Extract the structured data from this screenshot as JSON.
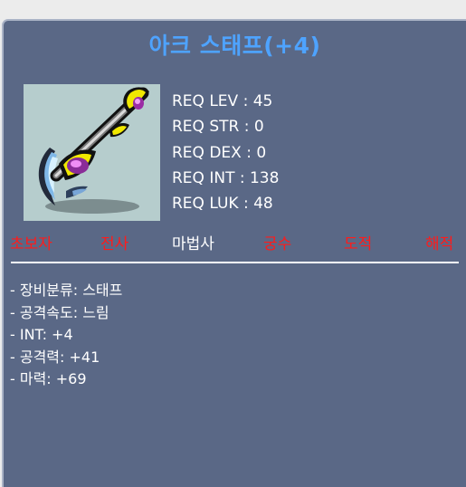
{
  "item": {
    "title": "아크 스태프(+4)",
    "icon": "arc-staff-weapon-icon"
  },
  "requirements": [
    "REQ LEV : 45",
    "REQ STR : 0",
    "REQ DEX : 0",
    "REQ INT : 138",
    "REQ LUK : 48"
  ],
  "jobs": [
    {
      "label": "초보자",
      "enabled": false
    },
    {
      "label": "전사",
      "enabled": false
    },
    {
      "label": "마법사",
      "enabled": true
    },
    {
      "label": "궁수",
      "enabled": false
    },
    {
      "label": "도적",
      "enabled": false
    },
    {
      "label": "해적",
      "enabled": false
    }
  ],
  "details": [
    "- 장비분류: 스태프",
    "- 공격속도: 느림",
    "- INT: +4",
    "- 공격력: +41",
    "- 마력: +69"
  ],
  "colors": {
    "panel_background": "#5a6886",
    "title": "#4ea3ff",
    "job_enabled": "#ffffff",
    "job_disabled": "#ff1b1b",
    "text": "#ffffff"
  }
}
